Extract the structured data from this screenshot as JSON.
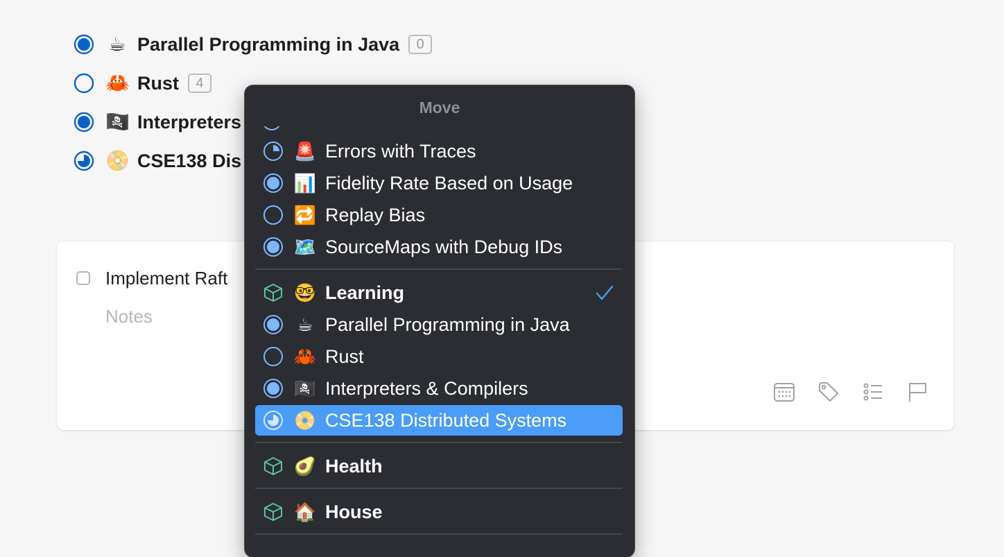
{
  "projects": [
    {
      "emoji": "☕",
      "title": "Parallel Programming in Java",
      "count": "0",
      "progress": 0.5
    },
    {
      "emoji": "🦀",
      "title": "Rust",
      "count": "4",
      "progress": 0.0
    },
    {
      "emoji": "🏴‍☠️",
      "title": "Interpreters",
      "progress": 0.5
    },
    {
      "emoji": "📀",
      "title": "CSE138 Dis",
      "progress": 0.75
    }
  ],
  "task": {
    "title": "Implement Raft",
    "notes_placeholder": "Notes"
  },
  "task_tools": [
    "calendar-icon",
    "tag-icon",
    "checklist-icon",
    "flag-icon"
  ],
  "menu": {
    "title": "Move",
    "items": [
      {
        "kind": "project",
        "emoji": "🚨",
        "label": "Errors with Traces",
        "progress": 0.25
      },
      {
        "kind": "project",
        "emoji": "📊",
        "label": "Fidelity Rate Based on Usage",
        "progress": 0.5
      },
      {
        "kind": "project",
        "emoji": "🔁",
        "label": "Replay Bias",
        "progress": 0.0
      },
      {
        "kind": "project",
        "emoji": "🗺️",
        "label": " SourceMaps with Debug IDs",
        "progress": 0.5
      },
      {
        "kind": "area",
        "emoji": "🤓",
        "label": "Learning",
        "checked": true
      },
      {
        "kind": "project",
        "emoji": "☕",
        "label": "Parallel Programming in Java",
        "progress": 0.5
      },
      {
        "kind": "project",
        "emoji": "🦀",
        "label": "Rust",
        "progress": 0.0
      },
      {
        "kind": "project",
        "emoji": "🏴‍☠️",
        "label": "Interpreters & Compilers",
        "progress": 0.5
      },
      {
        "kind": "project",
        "emoji": "📀",
        "label": "CSE138 Distributed Systems",
        "progress": 0.75,
        "selected": true
      },
      {
        "kind": "area",
        "emoji": "🥑",
        "label": "Health"
      },
      {
        "kind": "area",
        "emoji": "🏠",
        "label": "House"
      }
    ]
  },
  "colors": {
    "accent": "#0a62c9",
    "menu_pie": "#7cb7ff",
    "area_icon": "#59c49a",
    "selected_bg": "#4a9cf7",
    "checkmark": "#4a9cf7"
  }
}
